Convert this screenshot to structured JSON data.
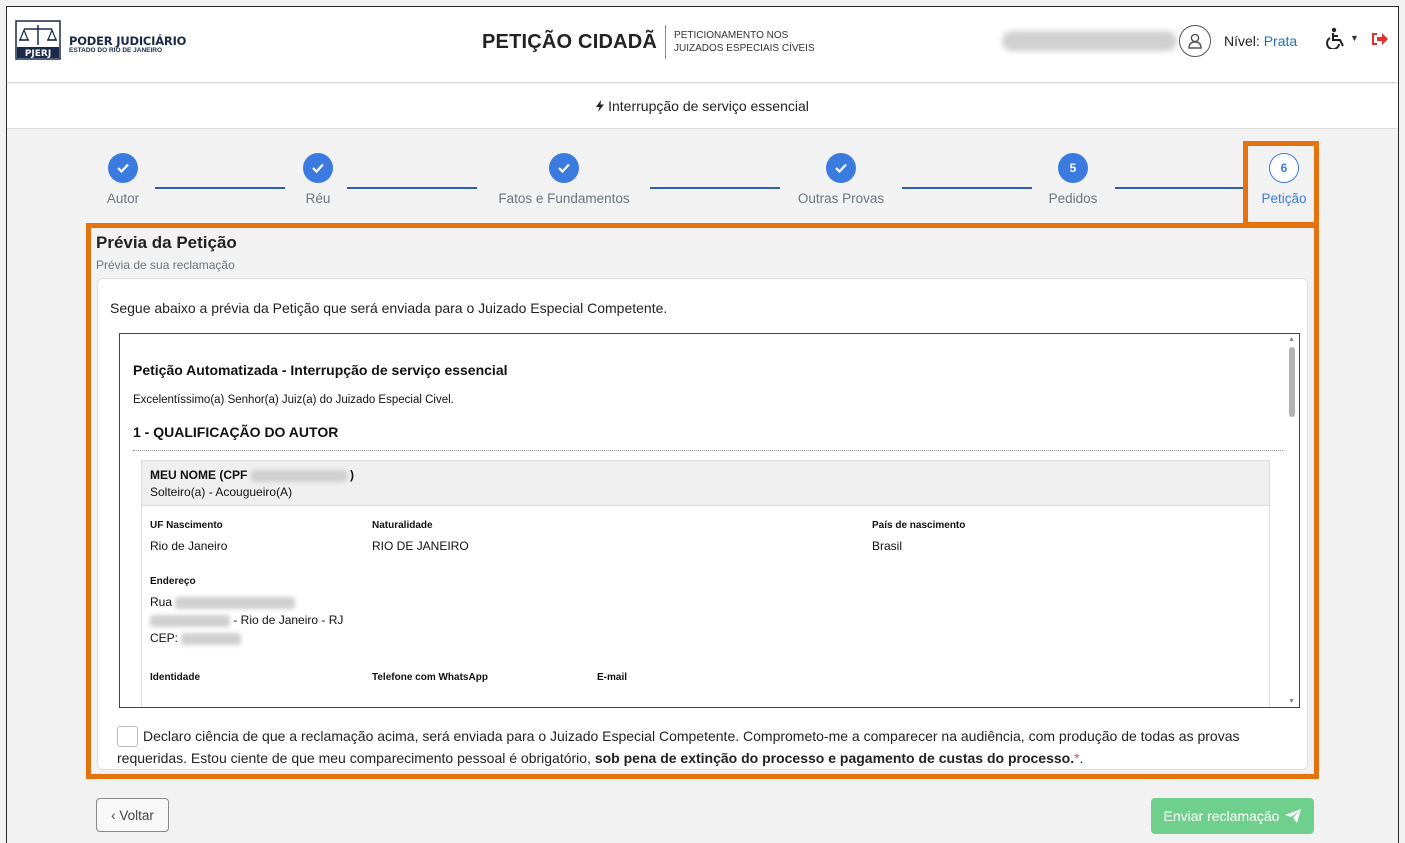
{
  "header": {
    "logo_title": "PODER JUDICIÁRIO",
    "logo_sub": "ESTADO DO RIO DE JANEIRO",
    "logo_badge": "PJERJ",
    "app_name": "PETIÇÃO CIDADÃ",
    "app_tag_line1": "PETICIONAMENTO NOS",
    "app_tag_line2": "JUIZADOS ESPECIAIS CÍVEIS",
    "level_label": "Nível:",
    "level_value": "Prata"
  },
  "subheader": {
    "topic": "Interrupção de serviço essencial"
  },
  "steps": [
    {
      "label": "Autor",
      "state": "done"
    },
    {
      "label": "Réu",
      "state": "done"
    },
    {
      "label": "Fatos e Fundamentos",
      "state": "done"
    },
    {
      "label": "Outras Provas",
      "state": "done"
    },
    {
      "label": "Pedidos",
      "state": "current",
      "number": "5"
    },
    {
      "label": "Petição",
      "state": "active",
      "number": "6"
    }
  ],
  "card": {
    "title": "Prévia da Petição",
    "subtitle": "Prévia de sua reclamação",
    "intro": "Segue abaixo a prévia da Petição que será enviada para o Juizado Especial Competente."
  },
  "doc": {
    "title": "Petição Automatizada - Interrupção de serviço essencial",
    "greeting": "Excelentíssimo(a) Senhor(a) Juiz(a) do Juizado Especial Civel.",
    "section1": "1 - QUALIFICAÇÃO DO AUTOR",
    "party_name": "MEU NOME (CPF",
    "party_name_close": ")",
    "party_status": "Solteiro(a) - Acougueiro(A)",
    "uf_label": "UF Nascimento",
    "uf_value": "Rio de Janeiro",
    "nat_label": "Naturalidade",
    "nat_value": "RIO DE JANEIRO",
    "country_label": "País de nascimento",
    "country_value": "Brasil",
    "address_label": "Endereço",
    "address_line1": "Rua",
    "address_line2": "- Rio de Janeiro - RJ",
    "address_line3": "CEP:",
    "id_label": "Identidade",
    "phone_label": "Telefone com WhatsApp",
    "email_label": "E-mail"
  },
  "declaration": {
    "text": "Declaro ciência de que a reclamação acima, será enviada para o Juizado Especial Competente. Comprometo-me a comparecer na audiência, com produção de todas as provas requeridas. Estou ciente de que meu comparecimento pessoal é obrigatório,",
    "bold": "sob pena de extinção do processo e pagamento de custas do processo.",
    "required_mark": "*",
    "end": "."
  },
  "buttons": {
    "back": "‹ Voltar",
    "send": "Enviar reclamação"
  },
  "colors": {
    "primary": "#3b7be0",
    "highlight": "#e4720f",
    "send_button": "#6fcf8c",
    "level_value": "#1e73be",
    "logout_icon": "#e0322f"
  },
  "icons": {
    "user": "user-circle-icon",
    "accessibility": "wheelchair-icon",
    "logout": "sign-out-icon",
    "bolt": "bolt-icon",
    "check": "check-icon",
    "send": "paper-plane-icon"
  }
}
